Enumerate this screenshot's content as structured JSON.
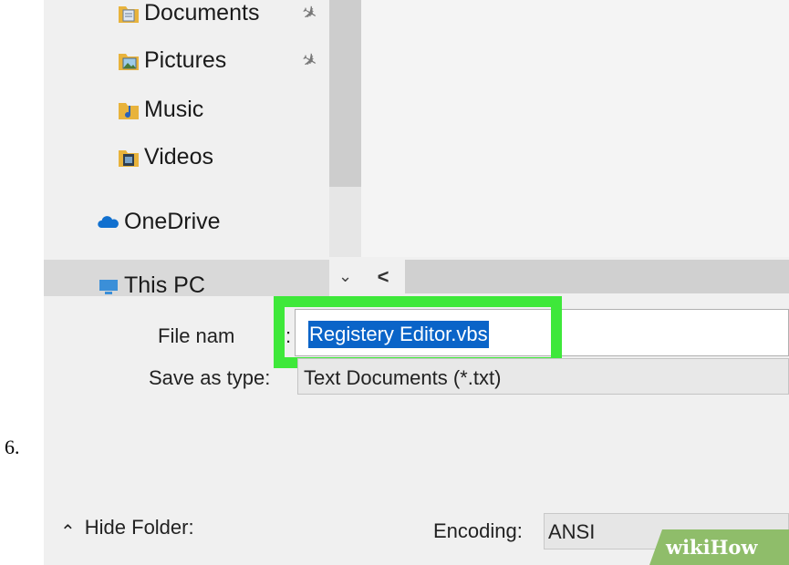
{
  "step_number": "6.",
  "nav": {
    "items": [
      {
        "label": "Documents",
        "icon": "documents-folder-icon",
        "pinned": true
      },
      {
        "label": "Pictures",
        "icon": "pictures-folder-icon",
        "pinned": true
      },
      {
        "label": "Music",
        "icon": "music-folder-icon",
        "pinned": false
      },
      {
        "label": "Videos",
        "icon": "videos-folder-icon",
        "pinned": false
      }
    ],
    "onedrive": "OneDrive",
    "this_pc": "This PC",
    "pin_glyph": "✈"
  },
  "scroll": {
    "down_glyph": "⌄",
    "left_glyph": "<"
  },
  "form": {
    "file_name_label": "File nam",
    "file_name_colon": ":",
    "file_name_value": "Registery Editor.vbs",
    "save_type_label": "Save as type:",
    "save_type_value": "Text Documents (*.txt)",
    "encoding_label": "Encoding:",
    "encoding_value": "ANSI"
  },
  "footer": {
    "hide_folders_label": "Hide Folder:",
    "hide_folders_glyph": "⌃"
  },
  "watermark": {
    "text": "wikiHow"
  },
  "colors": {
    "highlight_frame": "#3ee83a",
    "selection": "#0a64c8",
    "onedrive": "#1170cf"
  }
}
